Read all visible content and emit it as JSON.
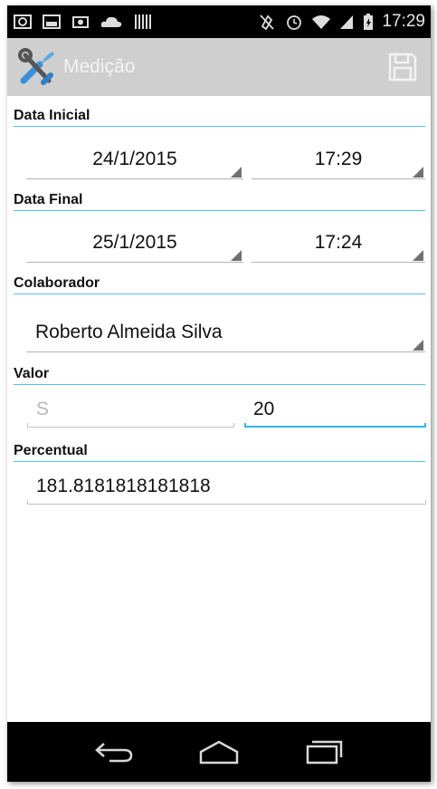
{
  "statusbar": {
    "time": "17:29",
    "left_icons": [
      "screenshot-icon",
      "image-icon",
      "camera-icon",
      "cloud-icon",
      "barcode-icon"
    ],
    "right_icons": [
      "mute-icon",
      "alarm-icon",
      "wifi-icon",
      "signal-icon",
      "battery-icon"
    ]
  },
  "actionbar": {
    "title": "Medição",
    "icon": "tools-icon",
    "save_icon": "save-icon",
    "background": "#cfcfcf"
  },
  "form": {
    "data_inicial": {
      "label": "Data Inicial",
      "date": "24/1/2015",
      "time": "17:29"
    },
    "data_final": {
      "label": "Data Final",
      "date": "25/1/2015",
      "time": "17:24"
    },
    "colaborador": {
      "label": "Colaborador",
      "value": "Roberto Almeida Silva"
    },
    "valor": {
      "label": "Valor",
      "prefix_placeholder": "S",
      "value": "20"
    },
    "percentual": {
      "label": "Percentual",
      "value": "181.8181818181818"
    }
  },
  "navbar": {
    "icons": [
      "back-icon",
      "home-icon",
      "recent-apps-icon"
    ]
  },
  "colors": {
    "accent": "#33b5e5",
    "section_line": "#4fc3e8"
  }
}
